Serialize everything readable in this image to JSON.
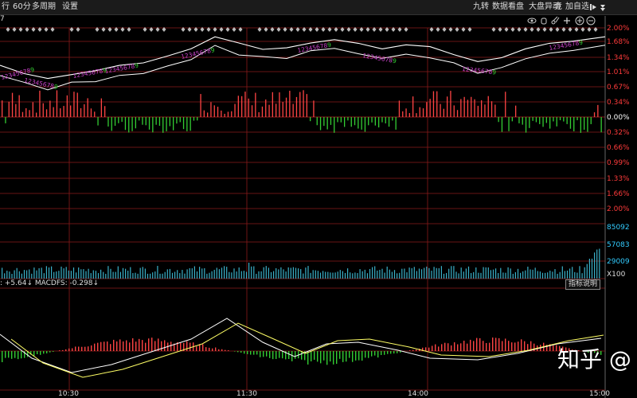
{
  "toolbar": {
    "left_items": [
      "行",
      "60分",
      "多周期",
      "设置"
    ],
    "right_items": [
      "九转",
      "数据看盘",
      "大盘异动",
      "竞",
      "加自选"
    ],
    "icons": [
      "pin-icon",
      "eye-icon",
      "hand-icon",
      "scissors-icon",
      "plus-icon",
      "plus-circle-icon"
    ]
  },
  "title_fragment": "7",
  "price_axis_labels": [
    "2.00%",
    "1.68%",
    "1.34%",
    "1.01%",
    "0.67%",
    "0.34%",
    "0.00%",
    "0.32%",
    "0.66%",
    "0.99%",
    "1.33%",
    "1.66%",
    "2.00%"
  ],
  "volume_axis_labels": [
    "85092",
    "57083",
    "29009",
    "X100"
  ],
  "time_labels": [
    "10:30",
    "11:30",
    "14:00",
    "15:00"
  ],
  "macd": {
    "label_text": ": +5.64↓ MACDFS: -0.298↓",
    "indicator_button": "指标说明"
  },
  "nine_turn_markers": [
    "123456789",
    "123456789",
    "123456789",
    "123456789",
    "123456789",
    "123456789",
    "123456789",
    "123456789"
  ],
  "watermark": "知乎 @",
  "colors": {
    "background": "#000000",
    "grid": "#8b1a1a",
    "up_bar": "#ff4444",
    "down_bar": "#33cc33",
    "axis_label": "#ff3b3b",
    "axis_label_neutral": "#ffffff",
    "volume_label": "#33ccff",
    "volume_bar": "#3ab0c8",
    "line_main": "#ffffff",
    "line_second": "#ffffff",
    "macd_dif": "#ffffff",
    "macd_dea": "#ffff66",
    "nine_turn": "#cc44cc",
    "nine_turn_end": "#33cc33"
  }
}
